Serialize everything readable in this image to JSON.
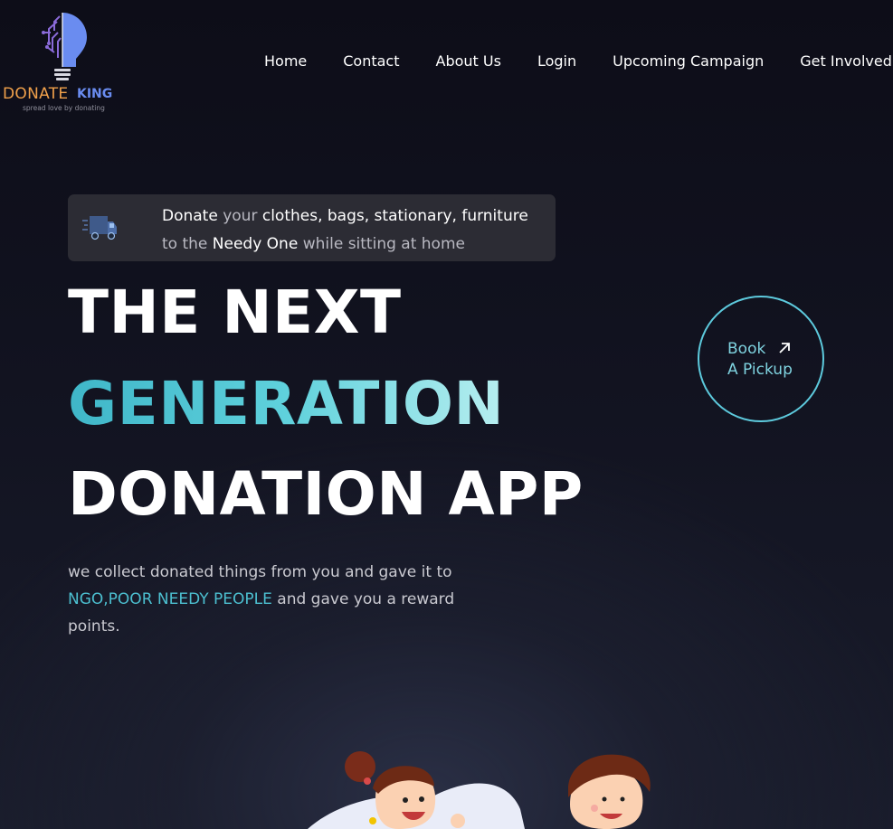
{
  "logo": {
    "word1": "DONATE",
    "word2": "KING",
    "tagline": "spread love by donating",
    "icon": "lightbulb-circuit-icon"
  },
  "nav": {
    "items": [
      "Home",
      "Contact",
      "About Us",
      "Login",
      "Upcoming Campaign",
      "Get Involved"
    ]
  },
  "banner": {
    "icon": "delivery-truck-icon",
    "line1": [
      "Donate",
      " your ",
      "clothes, bags, stationary, furniture"
    ],
    "line2": [
      "to the ",
      "Needy One",
      " while sitting at home"
    ]
  },
  "hero": {
    "line1": "THE NEXT",
    "line2": "GENERATION",
    "line3": "DONATION APP",
    "description_before": "we collect donated things from you and gave it to ",
    "description_accent": "NGO,POOR NEEDY PEOPLE",
    "description_after": " and gave you a reward points."
  },
  "pickup": {
    "line1": "Book",
    "line2": "A Pickup",
    "icon": "arrow-up-right-icon"
  },
  "illustration": {
    "icon": "cartoon-kids-illustration"
  },
  "colors": {
    "background": "#11121f",
    "accent": "#4cbfd0",
    "logo_orange": "#f0a04b",
    "logo_blue": "#6a8cf0",
    "banner_bg": "#2c2c34"
  }
}
